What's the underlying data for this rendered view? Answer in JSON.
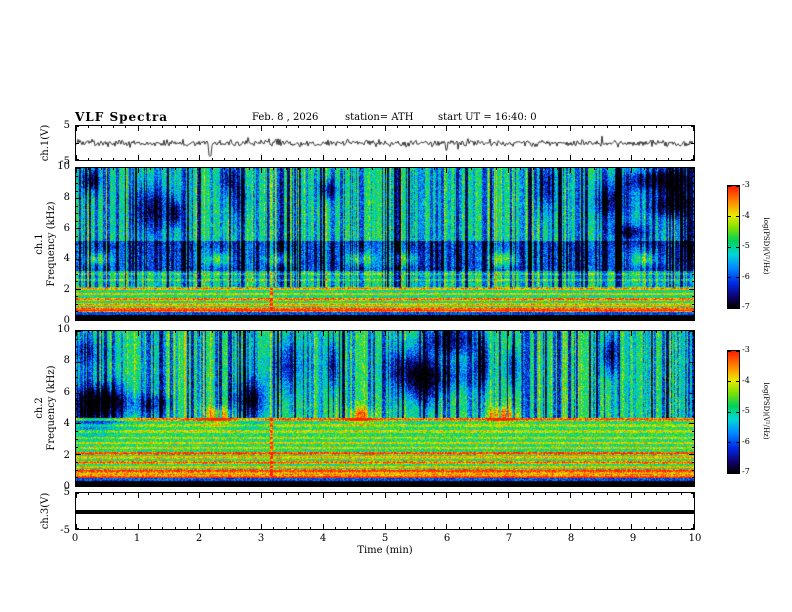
{
  "header": {
    "title": "VLF  Spectra",
    "date": "Feb. 8 , 2026",
    "station": "station= ATH",
    "start_ut": "start UT =  16:40: 0"
  },
  "xaxis": {
    "label": "Time  (min)",
    "range": [
      0,
      10
    ],
    "ticks": [
      0,
      1,
      2,
      3,
      4,
      5,
      6,
      7,
      8,
      9,
      10
    ]
  },
  "colorbars": [
    {
      "label": "log(PSD)(V²/Hz)",
      "ticks": [
        -3,
        -4,
        -5,
        -6,
        -7
      ],
      "range": [
        -7,
        -3
      ]
    },
    {
      "label": "log(PSD)(V²/Hz)",
      "ticks": [
        -3,
        -4,
        -5,
        -6,
        -7
      ],
      "range": [
        -7,
        -3
      ]
    }
  ],
  "chart_data": [
    {
      "type": "line",
      "name": "ch1-waveform",
      "ylabel": "ch.1(V)",
      "ylim": [
        -5,
        5
      ],
      "yticks": [
        5,
        -5
      ],
      "xlim": [
        0,
        10
      ],
      "description": "Broadband noise trace centered on 0 V, amplitude mostly within ±1.5 V, deep negative spike near t=2.2 min reaching about -4.5 V, smaller spike near t=6 min"
    },
    {
      "type": "heatmap",
      "name": "ch1-spectrogram",
      "ylabel_channel": "ch.1",
      "ylabel_axis": "Frequency (kHz)",
      "xlim": [
        0,
        10
      ],
      "ylim": [
        0,
        10
      ],
      "yticks": [
        0,
        2,
        4,
        6,
        8,
        10
      ],
      "value_range": [
        -7,
        -3
      ],
      "background_level": -4.9,
      "quiet_band_khz": [
        3.2,
        5.2
      ],
      "tones_khz": [
        0.5,
        0.7,
        1.0,
        1.35,
        1.7,
        2.05,
        2.6,
        3.0
      ],
      "tone_strength": [
        1.6,
        1.9,
        1.3,
        1.7,
        1.1,
        1.4,
        0.8,
        0.7
      ],
      "blob_times_min": [
        0.35,
        2.3,
        3.3,
        4.6,
        5.3,
        6.9,
        9.2
      ],
      "blob_freq_khz": 4.0,
      "bright_times_min": [
        3.15
      ],
      "streak_min_freq_khz": 2.1,
      "blackout_below_khz": 0.28,
      "description": "Green/cyan noise background with dense dark-blue vertical sferic streaks above ~2 kHz, quieter dark band 3-5 kHz with periodic cyan patches near 4 kHz, bright yellow horizontal tone lines below ~3 kHz, black band below ~0.3 kHz"
    },
    {
      "type": "heatmap",
      "name": "ch2-spectrogram",
      "ylabel_channel": "ch.2",
      "ylabel_axis": "Frequency (kHz)",
      "xlim": [
        0,
        10
      ],
      "ylim": [
        0,
        10
      ],
      "yticks": [
        0,
        2,
        4,
        6,
        8,
        10
      ],
      "value_range": [
        -7,
        -3
      ],
      "background_level": -4.8,
      "tones_khz": [
        0.5,
        0.7,
        0.95,
        1.2,
        1.5,
        1.8,
        2.1,
        2.45,
        2.75,
        3.1,
        3.5,
        3.9,
        4.3
      ],
      "tone_strength": [
        2.2,
        1.4,
        2.0,
        1.1,
        1.6,
        1.2,
        1.9,
        0.9,
        1.0,
        0.8,
        0.9,
        0.8,
        1.7
      ],
      "blob_times_min": [
        2.3,
        4.6,
        6.9
      ],
      "blob_freq_khz": 4.6,
      "bright_times_min": [
        3.15
      ],
      "streak_min_freq_khz": 4.4,
      "blackout_below_khz": 0.3,
      "description": "Dark-blue vertical streaks above ~4.5 kHz on green background; dense bright yellow/orange/red horizontal tone lines between 0.4 and 4.3 kHz; black band below ~0.3 kHz"
    },
    {
      "type": "line",
      "name": "ch3-waveform",
      "ylabel": "ch.3(V)",
      "ylim": [
        -5,
        5
      ],
      "yticks": [
        5,
        -5
      ],
      "xlim": [
        0,
        10
      ],
      "value": 0,
      "description": "Flat thick black line (constant ~0 V, dead channel)"
    }
  ]
}
